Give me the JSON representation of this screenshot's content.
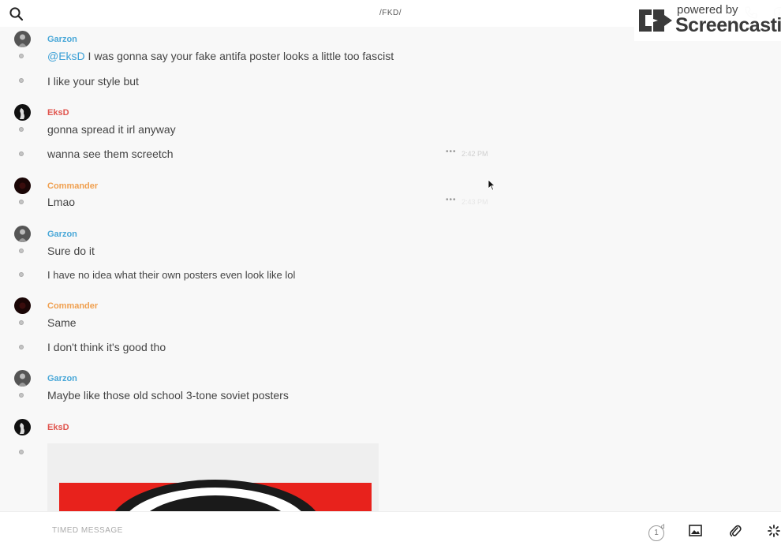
{
  "header": {
    "title": "/FKD/",
    "search_icon": "search-icon",
    "call_icon": "phone-icon",
    "info_icon": "info-icon"
  },
  "watermark": {
    "line1": "powered by",
    "line2": "Screencastify"
  },
  "colors": {
    "garzon": "#4aa8d8",
    "eksd": "#e0554e",
    "commander": "#f0a050",
    "mention": "#3a9fd6"
  },
  "messages": [
    {
      "author": "Garzon",
      "mention": "@EksD",
      "text": " I was gonna say your fake antifa poster looks a little too fascist"
    },
    {
      "text": "I like your style but"
    },
    {
      "author": "EksD",
      "text": "gonna spread it irl anyway"
    },
    {
      "text": "wanna see them screetch",
      "menu": "•••",
      "time": "2:42 PM"
    },
    {
      "author": "Commander",
      "text": "Lmao",
      "menu": "•••",
      "time": "2:43 PM"
    },
    {
      "author": "Garzon",
      "text": "Sure do it"
    },
    {
      "text": "I have no idea what their own posters even look like lol"
    },
    {
      "author": "Commander",
      "text": "Same"
    },
    {
      "text": "I don't think it's good tho"
    },
    {
      "author": "Garzon",
      "text": "Maybe like those old school 3-tone soviet posters"
    },
    {
      "author": "EksD",
      "attachment": "image"
    }
  ],
  "composer": {
    "placeholder": "TIMED MESSAGE",
    "timer_value": "1",
    "timer_unit": "d",
    "image_icon": "image-icon",
    "attach_icon": "paperclip-icon",
    "loader_icon": "loader-icon"
  }
}
